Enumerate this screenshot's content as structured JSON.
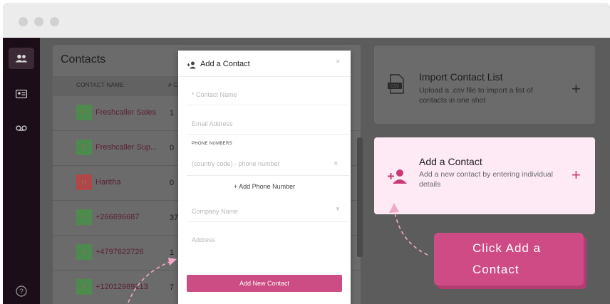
{
  "contacts": {
    "title": "Contacts",
    "col_name": "CONTACT NAME",
    "col_calls": "# CA",
    "rows": [
      {
        "initial": "F",
        "name": "Freshcaller Sales",
        "count": "1",
        "color": "#4d8a4d"
      },
      {
        "initial": "F",
        "name": "Freshcaller Sup...",
        "count": "0",
        "color": "#4d8a4d"
      },
      {
        "initial": "H",
        "name": "Haritha",
        "count": "0",
        "color": "#b04848"
      },
      {
        "initial": "+",
        "name": "+266696687",
        "count": "37",
        "color": "#4d8a4d"
      },
      {
        "initial": "+",
        "name": "+4797622726",
        "count": "1",
        "color": "#4d8a4d"
      },
      {
        "initial": "+",
        "name": "+12012989213",
        "count": "7",
        "color": "#4d8a4d"
      }
    ]
  },
  "import_card": {
    "title": "Import Contact List",
    "description": "Upload a .csv file to import a list of contacts in one shot",
    "plus": "+",
    "file_badge": "CSV"
  },
  "add_card": {
    "title": "Add a Contact",
    "description": "Add a new contact by entering individual details",
    "plus": "+"
  },
  "modal": {
    "title": "Add a Contact",
    "close": "×",
    "contact_name_required": "*",
    "contact_name": "Contact Name",
    "email": "Email Address",
    "phone_section": "PHONE NUMBERS",
    "phone_placeholder": "(country code) - phone number",
    "phone_remove": "×",
    "add_phone": "+ Add Phone Number",
    "company": "Company Name",
    "address": "Address",
    "submit": "Add New Contact"
  },
  "callout": {
    "line1": "Click Add a",
    "line2": "Contact"
  },
  "colors": {
    "accent": "#cc4d83",
    "callout": "#cf4b85",
    "highlight_card": "#fdeaf4"
  }
}
